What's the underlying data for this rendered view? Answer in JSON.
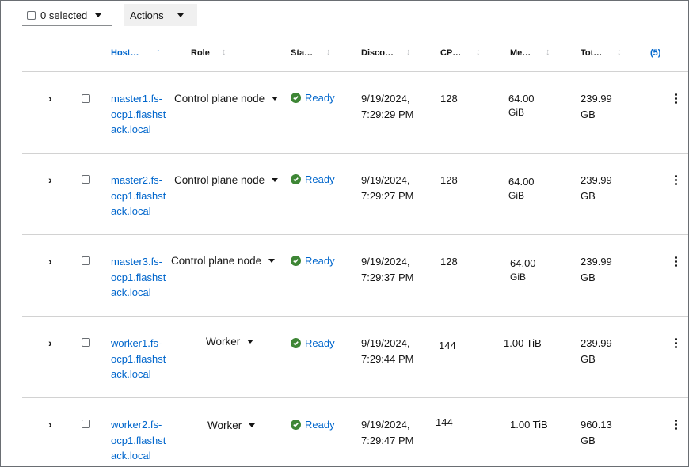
{
  "toolbar": {
    "selected_label": "0 selected",
    "actions_label": "Actions"
  },
  "columns": [
    {
      "label": "Host…"
    },
    {
      "label": "Role"
    },
    {
      "label": "Sta…"
    },
    {
      "label": "Disco…"
    },
    {
      "label": "CP…"
    },
    {
      "label": "Me…"
    },
    {
      "label": "Tot…"
    }
  ],
  "column_count": "(5)",
  "rows": [
    {
      "host": [
        "master1.fs-",
        "ocp1.flashst",
        "ack.local"
      ],
      "role": "Control plane node",
      "status": "Ready",
      "discovered": [
        "9/19/2024,",
        "7:29:29 PM"
      ],
      "cpu": "128",
      "memory": [
        "64.00",
        "GiB"
      ],
      "total": [
        "239.99",
        "GB"
      ]
    },
    {
      "host": [
        "master2.fs-",
        "ocp1.flashst",
        "ack.local"
      ],
      "role": "Control plane node",
      "status": "Ready",
      "discovered": [
        "9/19/2024,",
        "7:29:27 PM"
      ],
      "cpu": "128",
      "memory": [
        "64.00",
        "GiB"
      ],
      "total": [
        "239.99",
        "GB"
      ]
    },
    {
      "host": [
        "master3.fs-",
        "ocp1.flashst",
        "ack.local"
      ],
      "role": "Control plane node",
      "status": "Ready",
      "discovered": [
        "9/19/2024,",
        "7:29:37 PM"
      ],
      "cpu": "128",
      "memory": [
        "64.00",
        "GiB"
      ],
      "total": [
        "239.99",
        "GB"
      ]
    },
    {
      "host": [
        "worker1.fs-",
        "ocp1.flashst",
        "ack.local"
      ],
      "role": "Worker",
      "status": "Ready",
      "discovered": [
        "9/19/2024,",
        "7:29:44 PM"
      ],
      "cpu": "144",
      "memory": [
        "1.00 TiB",
        ""
      ],
      "total": [
        "239.99",
        "GB"
      ]
    },
    {
      "host": [
        "worker2.fs-",
        "ocp1.flashst",
        "ack.local"
      ],
      "role": "Worker",
      "status": "Ready",
      "discovered": [
        "9/19/2024,",
        "7:29:47 PM"
      ],
      "cpu": "144",
      "memory": [
        "1.00 TiB",
        ""
      ],
      "total": [
        "960.13",
        "GB"
      ]
    }
  ],
  "icons": {
    "sort_active": "arrow-up-icon",
    "sort_inactive": "sort-icon",
    "expand": "chevron-right-icon",
    "status": "check-circle-icon",
    "row_menu": "kebab-icon"
  },
  "colors": {
    "link": "#0066cc",
    "ready": "#3e8635",
    "divider": "#d2d2d2"
  }
}
